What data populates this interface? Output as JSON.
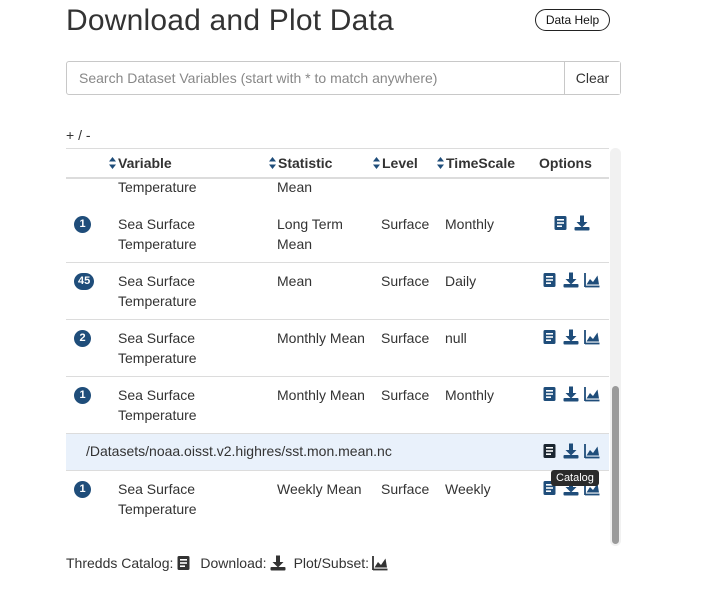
{
  "page": {
    "title": "Download and Plot Data",
    "help_button": "Data Help"
  },
  "search": {
    "placeholder": "Search Dataset Variables (start with * to match anywhere)",
    "value": "",
    "clear_label": "Clear"
  },
  "expand_toggle": "+ / -",
  "table": {
    "columns": [
      "Variable",
      "Statistic",
      "Level",
      "TimeScale",
      "Options"
    ],
    "partial_row": {
      "variable": "Temperature",
      "statistic": "Mean"
    },
    "rows": [
      {
        "count": "1",
        "variable": "Sea Surface Temperature",
        "statistic": "Long Term Mean",
        "level": "Surface",
        "timescale": "Monthly",
        "options": [
          "catalog-icon",
          "download-icon"
        ]
      },
      {
        "count": "45",
        "variable": "Sea Surface Temperature",
        "statistic": "Mean",
        "level": "Surface",
        "timescale": "Daily",
        "options": [
          "catalog-icon",
          "download-icon",
          "plot-icon"
        ]
      },
      {
        "count": "2",
        "variable": "Sea Surface Temperature",
        "statistic": "Monthly Mean",
        "level": "Surface",
        "timescale": "null",
        "options": [
          "catalog-icon",
          "download-icon",
          "plot-icon"
        ]
      },
      {
        "count": "1",
        "variable": "Sea Surface Temperature",
        "statistic": "Monthly Mean",
        "level": "Surface",
        "timescale": "Monthly",
        "options": [
          "catalog-icon",
          "download-icon",
          "plot-icon"
        ]
      }
    ],
    "path_row": {
      "path": "/Datasets/noaa.oisst.v2.highres/sst.mon.mean.nc",
      "options": [
        "catalog-icon",
        "download-icon",
        "plot-icon"
      ]
    },
    "last_row": {
      "count": "1",
      "variable": "Sea Surface Temperature",
      "statistic": "Weekly Mean",
      "level": "Surface",
      "timescale": "Weekly",
      "options": [
        "catalog-icon",
        "download-icon",
        "plot-icon"
      ]
    }
  },
  "tooltip": "Catalog",
  "legend": {
    "catalog_label": "Thredds Catalog:",
    "download_label": "Download:",
    "plot_label": "Plot/Subset:"
  },
  "colors": {
    "icon_blue": "#1f4d7a",
    "badge_bg": "#1f4d7a",
    "highlight_row": "#e9f1fb",
    "text": "#333333"
  }
}
